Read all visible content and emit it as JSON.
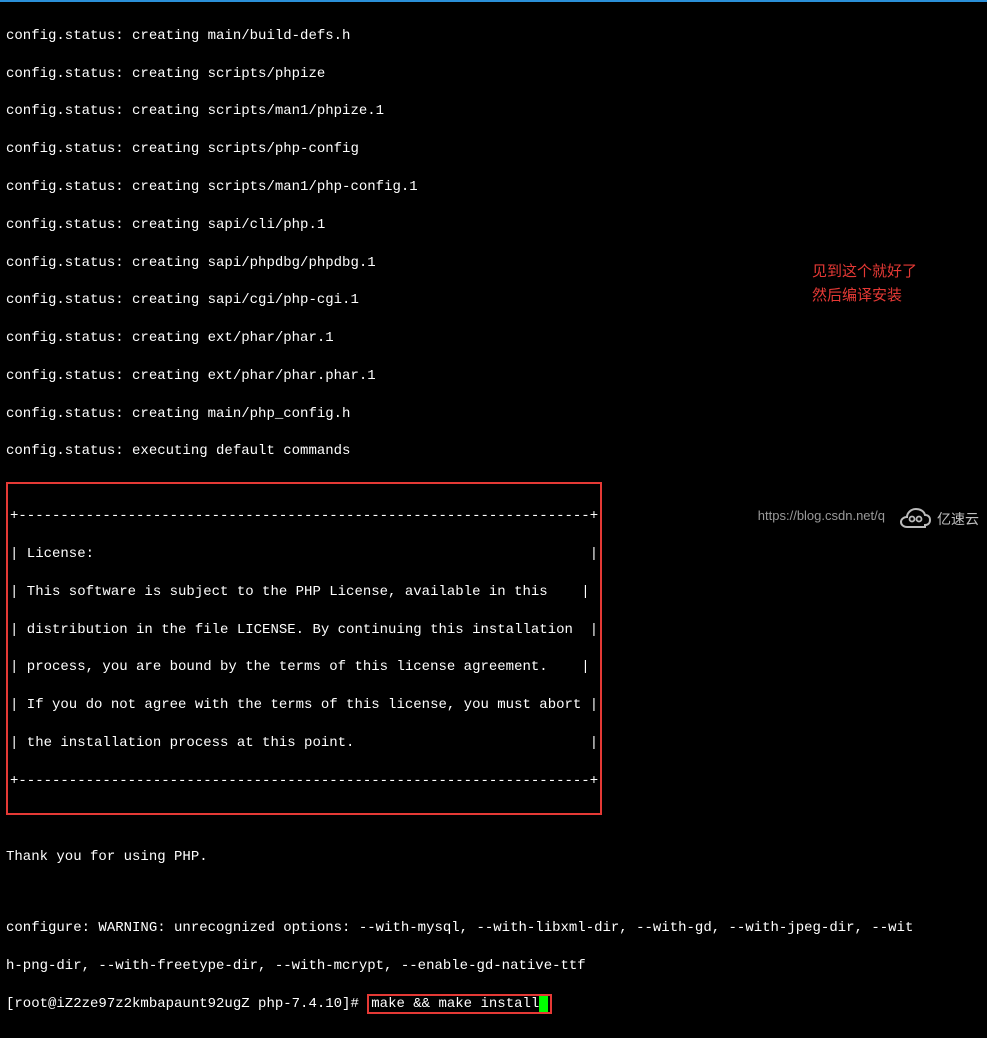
{
  "terminal": {
    "status_lines": [
      "config.status: creating main/build-defs.h",
      "config.status: creating scripts/phpize",
      "config.status: creating scripts/man1/phpize.1",
      "config.status: creating scripts/php-config",
      "config.status: creating scripts/man1/php-config.1",
      "config.status: creating sapi/cli/php.1",
      "config.status: creating sapi/phpdbg/phpdbg.1",
      "config.status: creating sapi/cgi/php-cgi.1",
      "config.status: creating ext/phar/phar.1",
      "config.status: creating ext/phar/phar.phar.1",
      "config.status: creating main/php_config.h",
      "config.status: executing default commands"
    ],
    "license_box": {
      "border_top": "+--------------------------------------------------------------------+",
      "lines": [
        "| License:                                                           |",
        "| This software is subject to the PHP License, available in this    |",
        "| distribution in the file LICENSE. By continuing this installation  |",
        "| process, you are bound by the terms of this license agreement.    |",
        "| If you do not agree with the terms of this license, you must abort |",
        "| the installation process at this point.                            |"
      ],
      "border_bottom": "+--------------------------------------------------------------------+"
    },
    "thank_you": "Thank you for using PHP.",
    "warning_line1": "configure: WARNING: unrecognized options: --with-mysql, --with-libxml-dir, --with-gd, --with-jpeg-dir, --wit",
    "warning_line2": "h-png-dir, --with-freetype-dir, --with-mcrypt, --enable-gd-native-ttf",
    "prompt": "[root@iZ2ze97z2kmbapaunt92ugZ php-7.4.10]# ",
    "command": "make && make install"
  },
  "annotation": {
    "line1": "见到这个就好了",
    "line2": "然后编译安装"
  },
  "watermark": {
    "url": "https://blog.csdn.net/q",
    "logo_text": "亿速云"
  }
}
